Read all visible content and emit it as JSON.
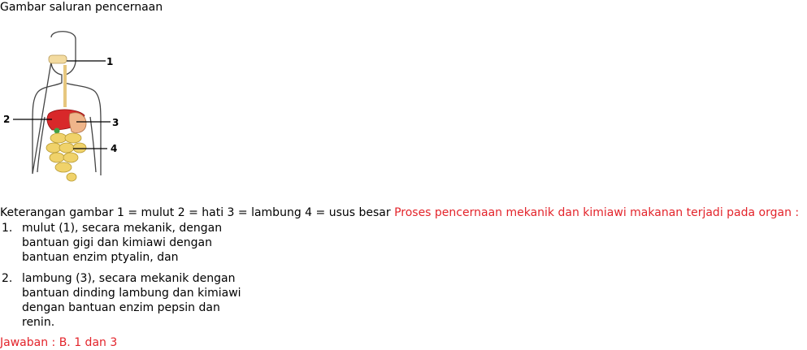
{
  "title": "Gambar saluran pencernaan",
  "figure": {
    "callouts": [
      "1",
      "2",
      "3",
      "4"
    ]
  },
  "paragraph": {
    "legend": "Keterangan gambar 1 = mulut 2 = hati 3 = lambung 4 = usus besar ",
    "question": "Proses pencernaan mekanik dan kimiawi makanan terjadi pada organ :"
  },
  "items": [
    {
      "num": "1.",
      "text": "mulut (1), secara mekanik, dengan bantuan gigi dan kimiawi dengan bantuan enzim ptyalin, dan"
    },
    {
      "num": "2.",
      "text": "lambung (3), secara mekanik dengan bantuan dinding lambung dan kimiawi dengan bantuan enzim pepsin dan renin."
    }
  ],
  "answer": "Jawaban : B. 1 dan 3",
  "colors": {
    "accent_red": "#e3242b"
  }
}
